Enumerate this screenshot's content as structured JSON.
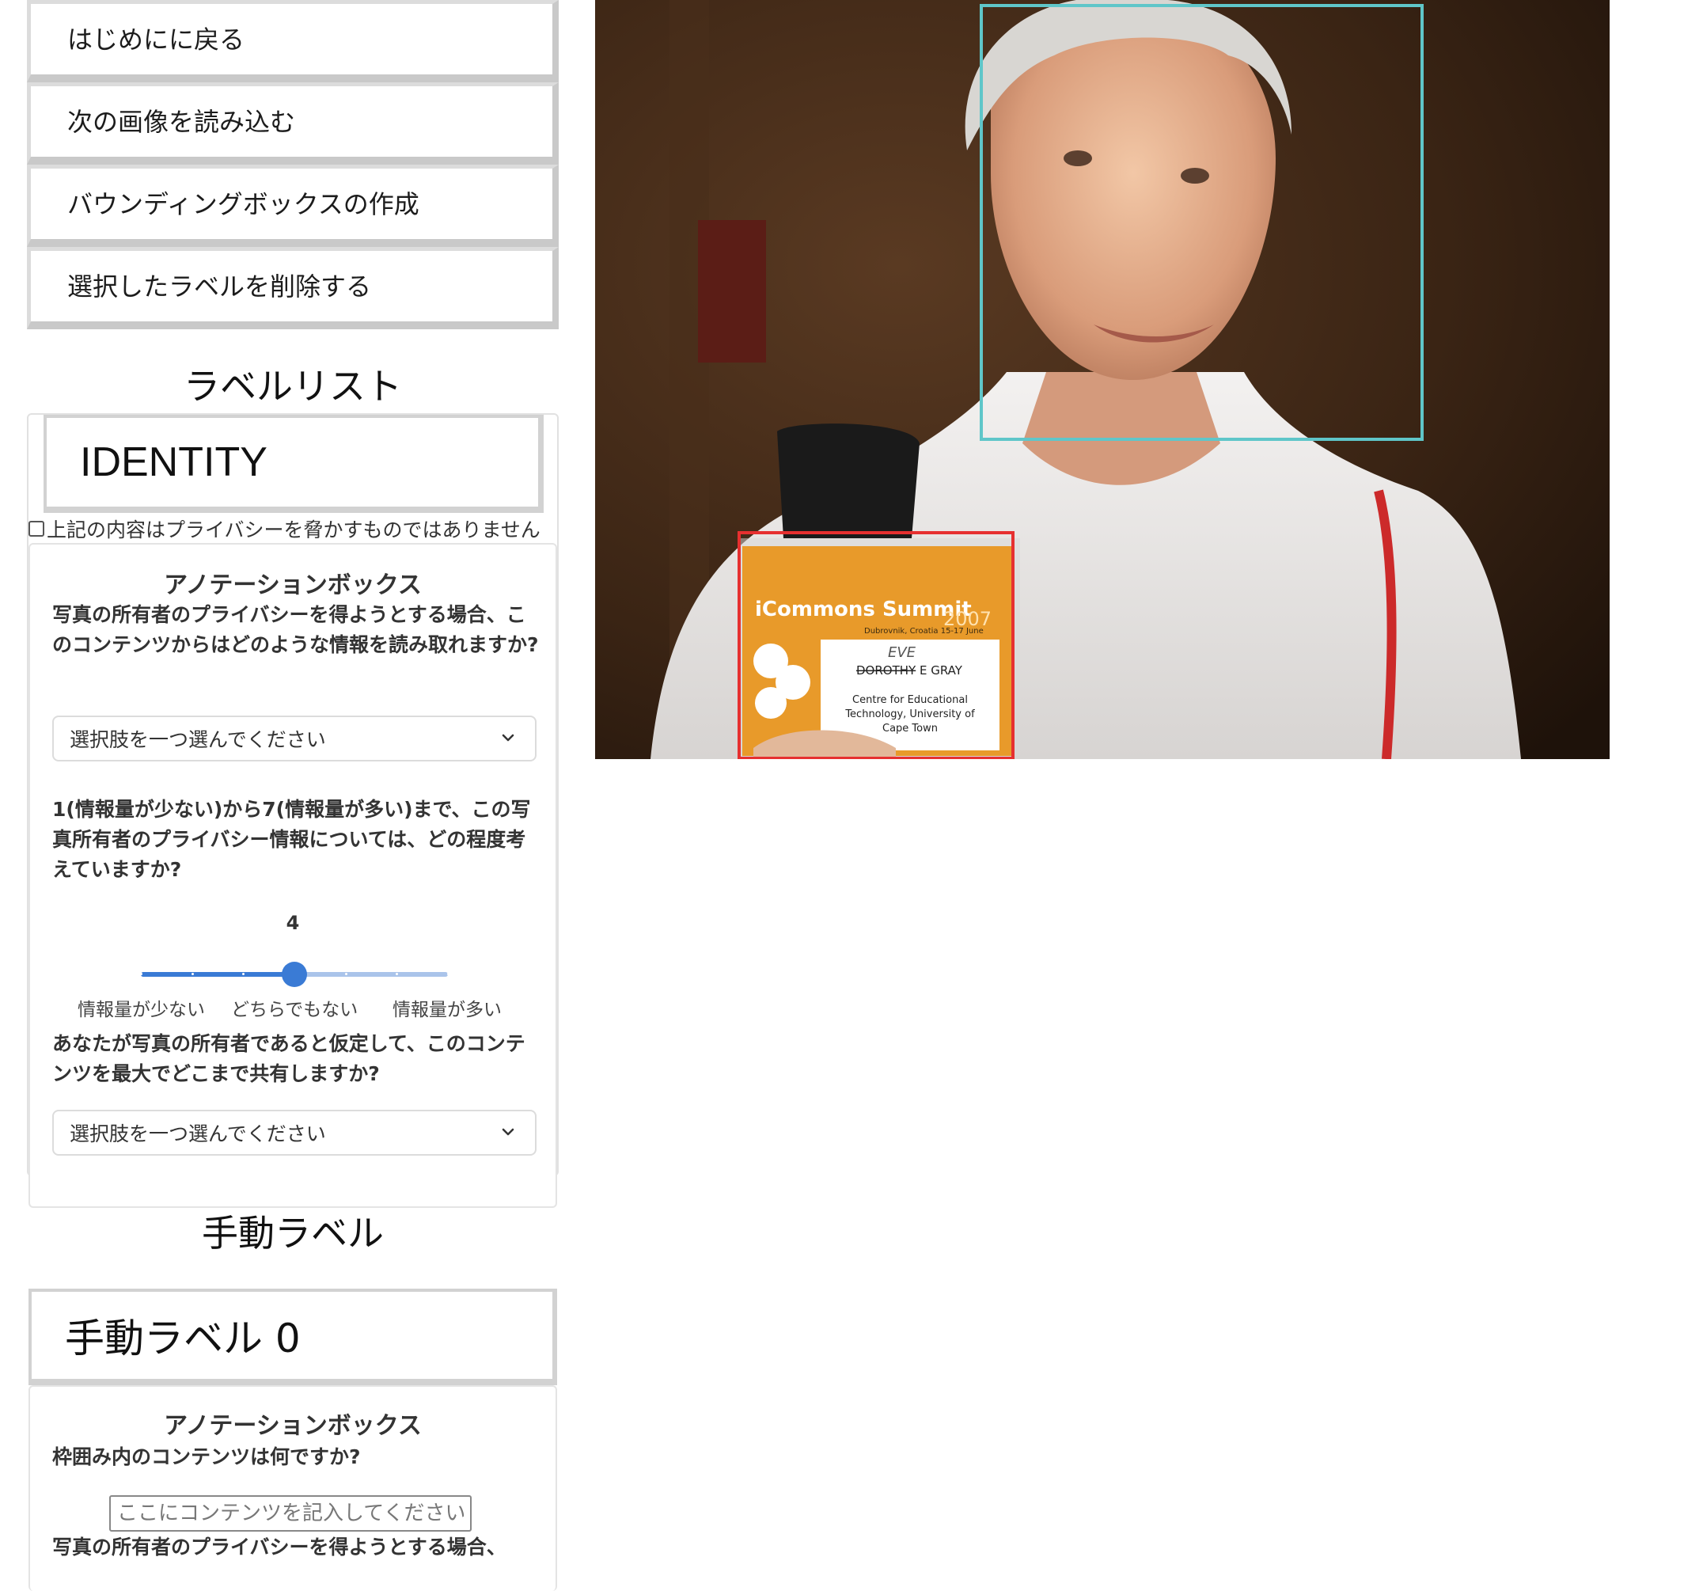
{
  "buttons": {
    "back": "はじめにに戻る",
    "next_image": "次の画像を読み込む",
    "create_bbox": "バウンディングボックスの作成",
    "delete_label": "選択したラベルを削除する"
  },
  "label_list": {
    "title": "ラベルリスト",
    "selected_label": "IDENTITY",
    "privacy_checkbox_label": "上記の内容はプライバシーを脅かすものではありません",
    "privacy_checked": false,
    "annotation": {
      "title": "アノテーションボックス",
      "q_info": "写真の所有者のプライバシーを得ようとする場合、このコンテンツからはどのような情報を読み取れますか?",
      "q_info_select": "選択肢を一つ選んでください",
      "q_scale": "1(情報量が少ない)から7(情報量が多い)まで、この写真所有者のプライバシー情報については、どの程度考えていますか?",
      "scale_value": "4",
      "scale_min": 1,
      "scale_max": 7,
      "scale_labels": {
        "low": "情報量が少ない",
        "mid": "どちらでもない",
        "high": "情報量が多い"
      },
      "q_share": "あなたが写真の所有者であると仮定して、このコンテンツを最大でどこまで共有しますか?",
      "q_share_select": "選択肢を一つ選んでください"
    }
  },
  "manual_label": {
    "title": "手動ラベル",
    "item_label": "手動ラベル 0",
    "annotation": {
      "title": "アノテーションボックス",
      "q_content": "枠囲み内のコンテンツは何ですか?",
      "content_placeholder": "ここにコンテンツを記入してください。",
      "q_info_partial": "写真の所有者のプライバシーを得ようとする場合、"
    }
  },
  "image": {
    "badge_title": "iCommons Summit",
    "badge_year": "2007",
    "badge_sub": "Dubrovnik, Croatia   15-17 June",
    "badge_handwritten": "EVE",
    "badge_name_struck": "DOROTHY",
    "badge_name": "E GRAY",
    "badge_org_lines": [
      "Centre for Educational",
      "Technology, University of",
      "Cape Town"
    ],
    "face_box_color": "#5fc6c9",
    "badge_box_color": "#e63030"
  },
  "colors": {
    "accent": "#3a7bd5"
  }
}
